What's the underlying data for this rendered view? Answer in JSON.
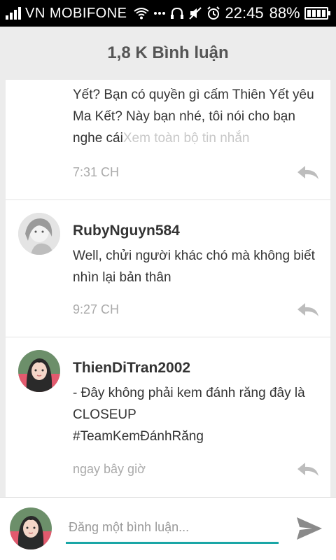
{
  "status_bar": {
    "carrier": "VN MOBIFONE",
    "time": "22:45",
    "battery": "88%"
  },
  "header": {
    "title": "1,8 K Bình luận"
  },
  "comments": [
    {
      "username": "",
      "text": "Yết? Bạn có quyền gì cấm Thiên Yết yêu Ma Kết? Này bạn nhé, tôi nói cho bạn nghe cái",
      "more_link": "Xem toàn bộ tin nhắn",
      "time": "7:31 CH"
    },
    {
      "username": "RubyNguyn584",
      "text": "Well, chửi người khác chó mà không biết nhìn lại bản thân",
      "time": "9:27 CH"
    },
    {
      "username": "ThienDiTran2002",
      "text": "- Đây không phải kem đánh răng đây là CLOSEUP\n#TeamKemĐánhRăng",
      "time": "ngay bây giờ"
    }
  ],
  "composer": {
    "placeholder": "Đăng một bình luận..."
  },
  "colors": {
    "accent": "#1aa6a6",
    "header_bg": "#ececec",
    "muted": "#aaaaaa"
  }
}
